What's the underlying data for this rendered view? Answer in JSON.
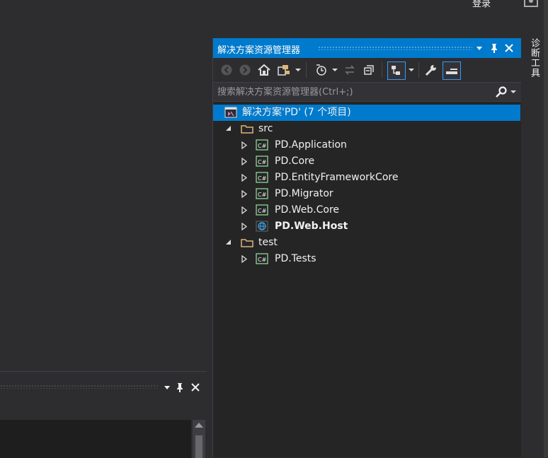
{
  "top_bar": {
    "login_label": "登录"
  },
  "solution_explorer": {
    "title": "解决方案资源管理器",
    "search_placeholder": "搜索解决方案资源管理器(Ctrl+;)",
    "tree": [
      {
        "label": "解决方案'PD' (7 个项目)",
        "kind": "solution",
        "selected": true
      },
      {
        "label": "src",
        "kind": "folder",
        "expanded": true
      },
      {
        "label": "PD.Application",
        "kind": "csharp-project"
      },
      {
        "label": "PD.Core",
        "kind": "csharp-project"
      },
      {
        "label": "PD.EntityFrameworkCore",
        "kind": "csharp-project"
      },
      {
        "label": "PD.Migrator",
        "kind": "csharp-project"
      },
      {
        "label": "PD.Web.Core",
        "kind": "csharp-project"
      },
      {
        "label": "PD.Web.Host",
        "kind": "web-project",
        "bold": true
      },
      {
        "label": "test",
        "kind": "folder",
        "expanded": true
      },
      {
        "label": "PD.Tests",
        "kind": "csharp-project"
      }
    ]
  },
  "right_sidebar": {
    "diagnostic_tools_tab": "诊断工具"
  },
  "colors": {
    "accent": "#007acc",
    "background": "#2d2d30",
    "panel": "#252526",
    "csharp_icon": "#8fd694"
  }
}
